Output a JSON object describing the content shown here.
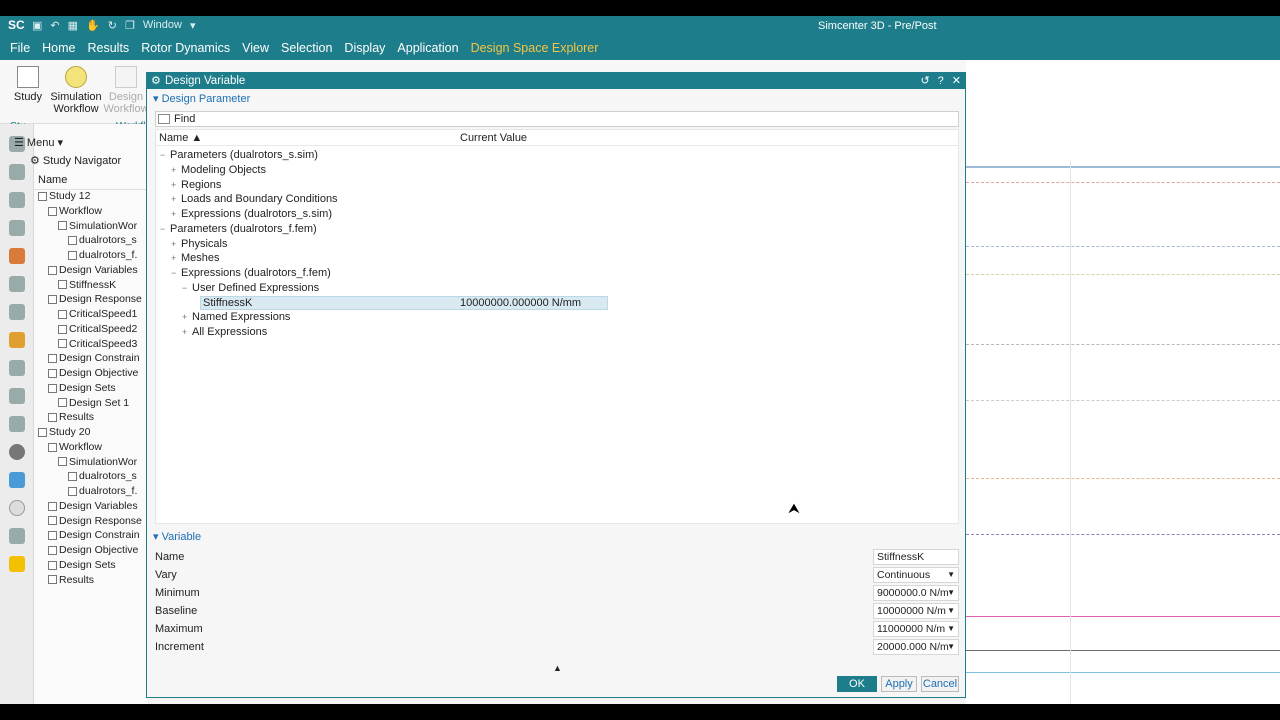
{
  "app": {
    "logo": "SC",
    "window_menu": "Window",
    "title": "Simcenter 3D - Pre/Post"
  },
  "menu": [
    "File",
    "Home",
    "Results",
    "Rotor Dynamics",
    "View",
    "Selection",
    "Display",
    "Application",
    "Design Space Explorer"
  ],
  "ribbon": {
    "study": "Study",
    "simulation_workflow": "Simulation Workflow",
    "design_workflow": "Design Workflow",
    "group_study": "Stu...",
    "group_workflow": "Workfl"
  },
  "navigator": {
    "menu_label": "Menu",
    "title": "Study Navigator",
    "col_name": "Name",
    "rows": [
      {
        "indent": 0,
        "label": "Study 12"
      },
      {
        "indent": 1,
        "label": "Workflow"
      },
      {
        "indent": 2,
        "label": "SimulationWor"
      },
      {
        "indent": 3,
        "label": "dualrotors_s"
      },
      {
        "indent": 3,
        "label": "dualrotors_f."
      },
      {
        "indent": 1,
        "label": "Design Variables"
      },
      {
        "indent": 2,
        "label": "StiffnessK"
      },
      {
        "indent": 1,
        "label": "Design Response"
      },
      {
        "indent": 2,
        "label": "CriticalSpeed1"
      },
      {
        "indent": 2,
        "label": "CriticalSpeed2"
      },
      {
        "indent": 2,
        "label": "CriticalSpeed3"
      },
      {
        "indent": 1,
        "label": "Design Constrain"
      },
      {
        "indent": 1,
        "label": "Design Objective"
      },
      {
        "indent": 1,
        "label": "Design Sets"
      },
      {
        "indent": 2,
        "label": "Design Set 1"
      },
      {
        "indent": 1,
        "label": "Results"
      },
      {
        "indent": 0,
        "label": "Study 20"
      },
      {
        "indent": 1,
        "label": "Workflow"
      },
      {
        "indent": 2,
        "label": "SimulationWor"
      },
      {
        "indent": 3,
        "label": "dualrotors_s"
      },
      {
        "indent": 3,
        "label": "dualrotors_f."
      },
      {
        "indent": 1,
        "label": "Design Variables"
      },
      {
        "indent": 1,
        "label": "Design Response"
      },
      {
        "indent": 1,
        "label": "Design Constrain"
      },
      {
        "indent": 1,
        "label": "Design Objective"
      },
      {
        "indent": 1,
        "label": "Design Sets"
      },
      {
        "indent": 1,
        "label": "Results"
      }
    ]
  },
  "dialog": {
    "title": "Design Variable",
    "section_parameter": "Design Parameter",
    "find_label": "Find",
    "col_name": "Name",
    "col_value": "Current Value",
    "tree": [
      {
        "indent": 0,
        "toggle": "−",
        "label": "Parameters (dualrotors_s.sim)",
        "value": ""
      },
      {
        "indent": 1,
        "toggle": "+",
        "label": "Modeling Objects",
        "value": ""
      },
      {
        "indent": 1,
        "toggle": "+",
        "label": "Regions",
        "value": ""
      },
      {
        "indent": 1,
        "toggle": "+",
        "label": "Loads and Boundary Conditions",
        "value": ""
      },
      {
        "indent": 1,
        "toggle": "+",
        "label": "Expressions (dualrotors_s.sim)",
        "value": ""
      },
      {
        "indent": 0,
        "toggle": "−",
        "label": "Parameters (dualrotors_f.fem)",
        "value": ""
      },
      {
        "indent": 1,
        "toggle": "+",
        "label": "Physicals",
        "value": ""
      },
      {
        "indent": 1,
        "toggle": "+",
        "label": "Meshes",
        "value": ""
      },
      {
        "indent": 1,
        "toggle": "−",
        "label": "Expressions (dualrotors_f.fem)",
        "value": ""
      },
      {
        "indent": 2,
        "toggle": "−",
        "label": "User Defined Expressions",
        "value": ""
      },
      {
        "indent": 3,
        "toggle": "",
        "label": "StiffnessK",
        "value": "10000000.000000 N/mm",
        "selected": true
      },
      {
        "indent": 2,
        "toggle": "+",
        "label": "Named Expressions",
        "value": ""
      },
      {
        "indent": 2,
        "toggle": "+",
        "label": "All Expressions",
        "value": ""
      }
    ],
    "section_variable": "Variable",
    "variable": {
      "name_label": "Name",
      "name_value": "StiffnessK",
      "vary_label": "Vary",
      "vary_value": "Continuous",
      "minimum_label": "Minimum",
      "minimum_value": "9000000.0 N/m",
      "baseline_label": "Baseline",
      "baseline_value": "10000000 N/m",
      "maximum_label": "Maximum",
      "maximum_value": "11000000 N/m",
      "increment_label": "Increment",
      "increment_value": "20000.000 N/m"
    },
    "ok": "OK",
    "apply": "Apply",
    "cancel": "Cancel"
  }
}
